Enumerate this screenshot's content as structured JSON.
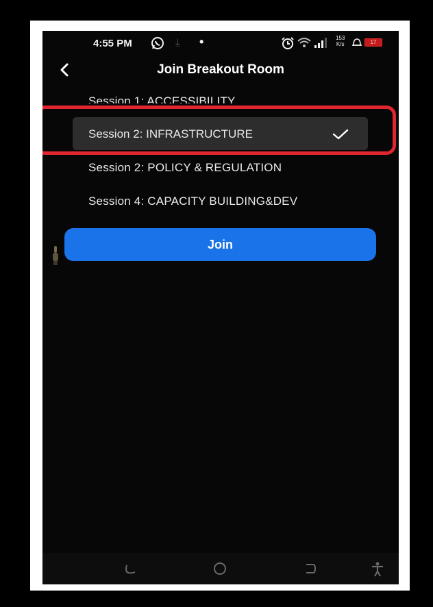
{
  "status_bar": {
    "time": "4:55 PM",
    "net_speed_value": "153",
    "net_speed_unit": "K/s",
    "battery_level": "17"
  },
  "header": {
    "title": "Join Breakout Room",
    "back_icon": "chevron-left-icon"
  },
  "sessions": [
    {
      "label": "Session 1: ACCESSIBILITY",
      "selected": false
    },
    {
      "label": "Session 2: INFRASTRUCTURE",
      "selected": true
    },
    {
      "label": "Session 2: POLICY & REGULATION",
      "selected": false
    },
    {
      "label": "Session 4: CAPACITY BUILDING&DEV",
      "selected": false
    }
  ],
  "join_button": {
    "label": "Join"
  },
  "colors": {
    "accent": "#1a73e8",
    "highlight": "#e0262f",
    "selected_row": "#2d2d2d",
    "background": "#070707"
  }
}
